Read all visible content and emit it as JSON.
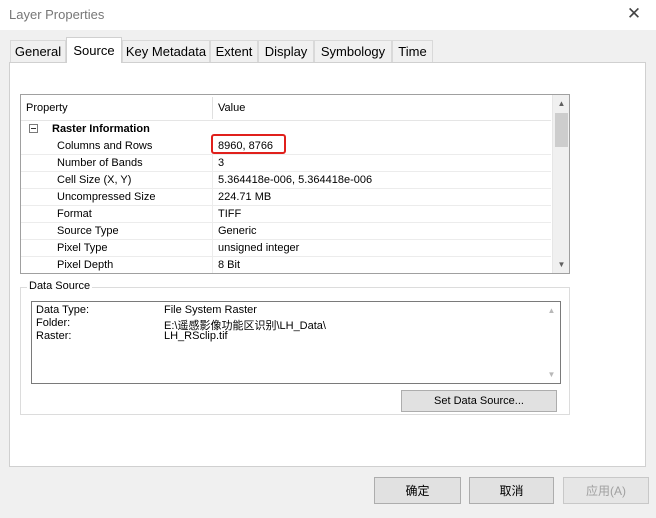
{
  "window": {
    "title": "Layer Properties",
    "close_glyph": "✕"
  },
  "tabs": [
    {
      "label": "General"
    },
    {
      "label": "Source"
    },
    {
      "label": "Key Metadata"
    },
    {
      "label": "Extent"
    },
    {
      "label": "Display"
    },
    {
      "label": "Symbology"
    },
    {
      "label": "Time"
    }
  ],
  "active_tab": "Source",
  "properties": {
    "header_property": "Property",
    "header_value": "Value",
    "section_title": "Raster Information",
    "rows": [
      {
        "label": "Columns and Rows",
        "value": "8960, 8766"
      },
      {
        "label": "Number of Bands",
        "value": "3"
      },
      {
        "label": "Cell Size (X, Y)",
        "value": "5.364418e-006, 5.364418e-006"
      },
      {
        "label": "Uncompressed Size",
        "value": "224.71 MB"
      },
      {
        "label": "Format",
        "value": "TIFF"
      },
      {
        "label": "Source Type",
        "value": "Generic"
      },
      {
        "label": "Pixel Type",
        "value": "unsigned integer"
      },
      {
        "label": "Pixel Depth",
        "value": "8 Bit"
      }
    ],
    "scroll_up": "▲",
    "scroll_down": "▼"
  },
  "data_source": {
    "legend": "Data Source",
    "rows": [
      {
        "key": "Data Type:",
        "value": "File System Raster"
      },
      {
        "key": "Folder:",
        "value": "E:\\遥感影像功能区识别\\LH_Data\\"
      },
      {
        "key": "Raster:",
        "value": "LH_RSclip.tif"
      }
    ],
    "set_button": "Set Data Source..."
  },
  "buttons": {
    "ok": "确定",
    "cancel": "取消",
    "apply": "应用(A)"
  },
  "colors": {
    "highlight": "#e0201c",
    "panel": "#ffffff",
    "chrome": "#f0f0f0"
  }
}
